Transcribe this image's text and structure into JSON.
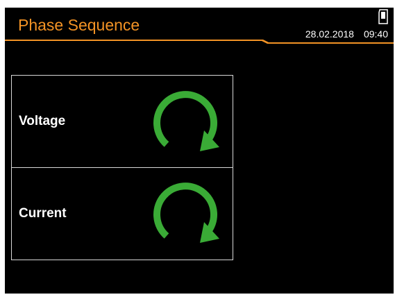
{
  "header": {
    "title": "Phase Sequence",
    "date": "28.02.2018",
    "time": "09:40",
    "storage_icon": "sd-card-icon"
  },
  "rows": [
    {
      "label": "Voltage",
      "icon": "clockwise-rotation-icon"
    },
    {
      "label": "Current",
      "icon": "clockwise-rotation-icon"
    }
  ],
  "colors": {
    "background": "#000000",
    "accent": "#f39325",
    "rotation": "#3aab36",
    "text": "#ffffff",
    "border": "#d9d9d9"
  }
}
